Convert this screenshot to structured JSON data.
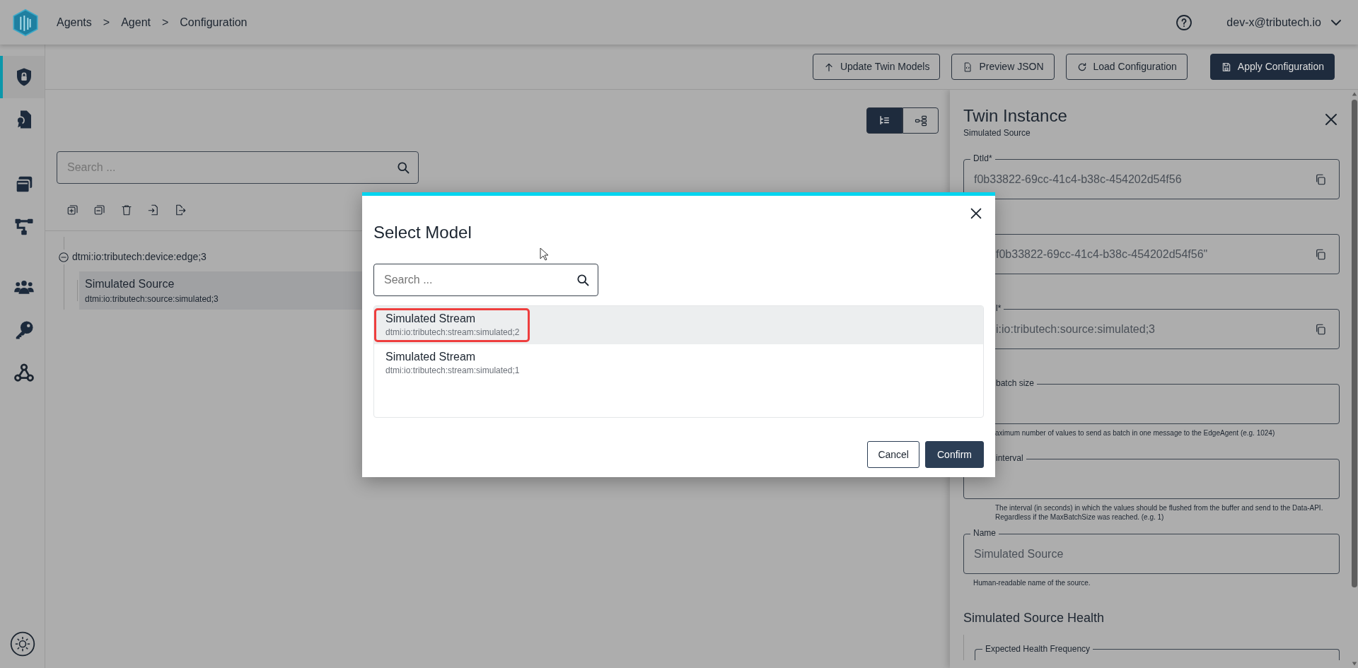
{
  "header": {
    "breadcrumbs": [
      "Agents",
      "Agent",
      "Configuration"
    ],
    "separator": ">",
    "user": "dev-x@tributech.io"
  },
  "sidebar": {
    "items": [
      {
        "selected": true
      },
      {
        "selected": false
      },
      {
        "selected": false
      },
      {
        "selected": false
      },
      {
        "selected": false
      },
      {
        "selected": false
      },
      {
        "selected": false
      }
    ]
  },
  "toolbar": {
    "buttons": [
      {
        "label": "Update Twin Models",
        "kind": "outline"
      },
      {
        "label": "Preview JSON",
        "kind": "outline"
      },
      {
        "label": "Load Configuration",
        "kind": "outline"
      },
      {
        "label": "Apply Configuration",
        "kind": "primary"
      }
    ]
  },
  "view_toggle": [
    {
      "selected": true
    },
    {
      "selected": false
    }
  ],
  "tree": {
    "search": {
      "placeholder": "Search ..."
    },
    "nodes": [
      {
        "label": "dtmi:io:tributech:device:edge;3",
        "expanded": true,
        "children": [
          {
            "title": "Simulated Source",
            "subtitle": "dtmi:io:tributech:source:simulated;3",
            "selected": true
          }
        ]
      }
    ]
  },
  "panel": {
    "title": "Twin Instance",
    "subtitle": "Simulated Source",
    "fields": [
      {
        "label": "DtId*",
        "value": "f0b33822-69cc-41c4-b38c-454202d54f56",
        "copy": true
      },
      {
        "value": "f0b33822-69cc-41c4-b38c-454202d54f56\"",
        "copy": true
      },
      {
        "label": "l*",
        "value": "i:io:tributech:source:simulated;3",
        "copy": true
      },
      {
        "label": "batch size",
        "hint": "aximum number of values to send as batch in one message to the EdgeAgent (e.g. 1024)"
      },
      {
        "label": "interval",
        "hint": "The interval (in seconds) in which the values should be flushed from the buffer and send to the Data-API. Regardless if the MaxBatchSize was reached. (e.g. 1)"
      },
      {
        "label": "Name",
        "value": "Simulated Source",
        "hint": "Human-readable name of the source."
      }
    ],
    "section": {
      "title": "Simulated Source Health",
      "fields": [
        {
          "label": "Expected Health Frequency"
        }
      ]
    }
  },
  "modal": {
    "title": "Select Model",
    "search": {
      "placeholder": "Search ..."
    },
    "items": [
      {
        "title": "Simulated Stream",
        "subtitle": "dtmi:io:tributech:stream:simulated;2",
        "selected": true,
        "highlighted": true
      },
      {
        "title": "Simulated Stream",
        "subtitle": "dtmi:io:tributech:stream:simulated;1",
        "selected": false,
        "highlighted": false
      }
    ],
    "buttons": [
      {
        "label": "Cancel",
        "kind": "outline"
      },
      {
        "label": "Confirm",
        "kind": "primary"
      }
    ]
  }
}
